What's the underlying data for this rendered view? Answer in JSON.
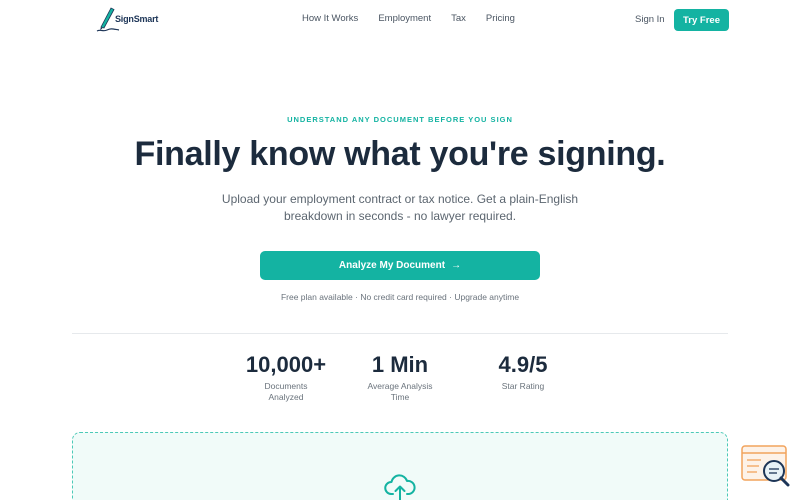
{
  "header": {
    "logo_text": "SignSmart",
    "nav": [
      "How It Works",
      "Employment",
      "Tax",
      "Pricing"
    ],
    "sign_in": "Sign In",
    "try_free": "Try Free"
  },
  "hero": {
    "eyebrow": "UNDERSTAND ANY DOCUMENT BEFORE YOU SIGN",
    "headline": "Finally know what you're signing.",
    "subhead": "Upload your employment contract or tax notice. Get a plain-English breakdown in seconds - no lawyer required.",
    "cta_label": "Analyze My Document",
    "cta_arrow": "→",
    "fineprint": "Free plan available · No credit card required · Upgrade anytime"
  },
  "stats": [
    {
      "value": "10,000+",
      "label": "Documents Analyzed"
    },
    {
      "value": "1 Min",
      "label": "Average Analysis Time"
    },
    {
      "value": "4.9/5",
      "label": "Star Rating"
    }
  ],
  "icons": {
    "logo": "pen-signature-icon",
    "upload": "cloud-upload-icon",
    "widget": "document-search-icon"
  },
  "colors": {
    "accent": "#14b3a2",
    "heading": "#1c2b3d",
    "widget_orange": "#f2a35c"
  }
}
